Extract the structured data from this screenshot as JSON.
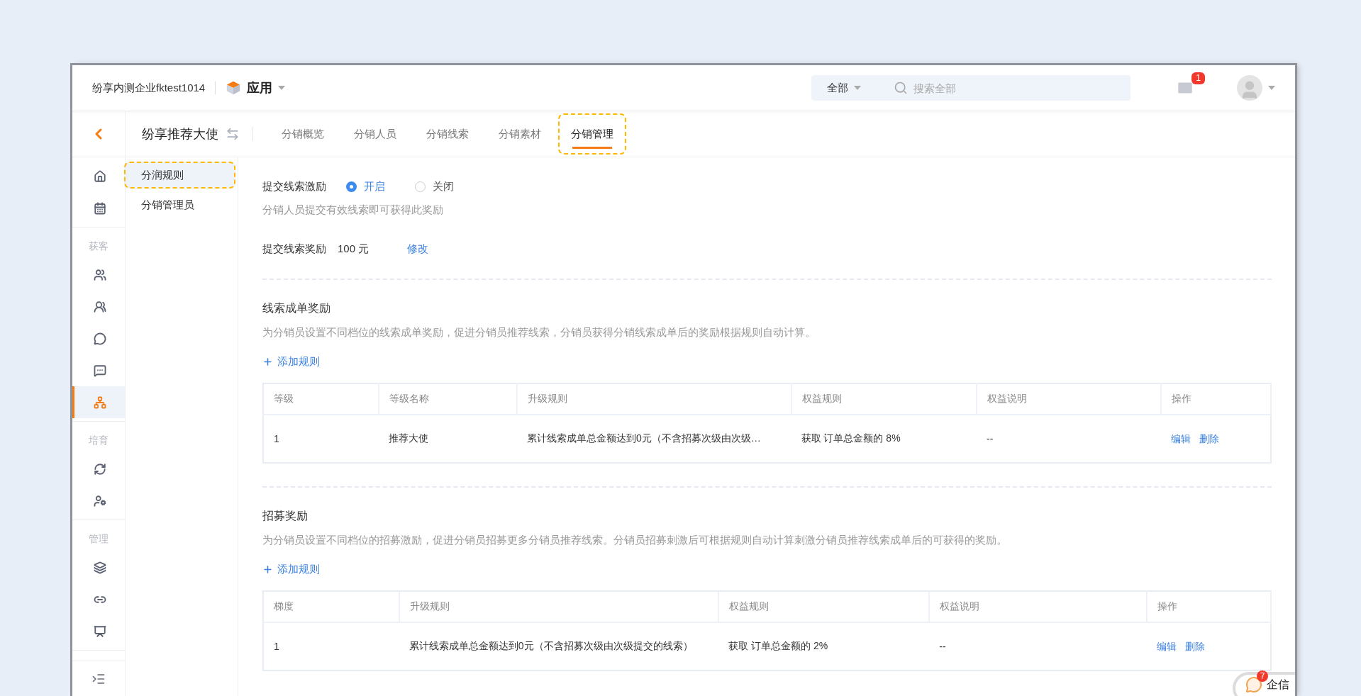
{
  "header": {
    "company": "纷享内测企业fktest1014",
    "app_menu": "应用",
    "search": {
      "scope": "全部",
      "placeholder": "搜索全部"
    },
    "mail_badge": "1"
  },
  "nav_sidebar": {
    "groups": [
      {
        "items": [
          {
            "selected": false
          },
          {
            "selected": false
          }
        ]
      },
      {
        "label": "获客",
        "items": [
          {
            "selected": false
          },
          {
            "selected": false
          },
          {
            "selected": false
          },
          {
            "selected": false
          },
          {
            "selected": true
          }
        ]
      },
      {
        "label": "培育",
        "items": [
          {
            "selected": false
          },
          {
            "selected": false
          }
        ]
      },
      {
        "label": "管理",
        "items": [
          {
            "selected": false
          },
          {
            "selected": false
          },
          {
            "selected": false
          }
        ]
      }
    ]
  },
  "app_title": "纷享推荐大使",
  "tabs": [
    {
      "label": "分销概览",
      "selected": false,
      "highlighted": false
    },
    {
      "label": "分销人员",
      "selected": false,
      "highlighted": false
    },
    {
      "label": "分销线索",
      "selected": false,
      "highlighted": false
    },
    {
      "label": "分销素材",
      "selected": false,
      "highlighted": false
    },
    {
      "label": "分销管理",
      "selected": true,
      "highlighted": true
    }
  ],
  "sub_menu": [
    {
      "label": "分润规则",
      "selected": true,
      "highlighted": true
    },
    {
      "label": "分销管理员",
      "selected": false,
      "highlighted": false
    }
  ],
  "incentive": {
    "label": "提交线索激励",
    "options": [
      {
        "label": "开启",
        "selected": true
      },
      {
        "label": "关闭",
        "selected": false
      }
    ],
    "hint": "分销人员提交有效线索即可获得此奖励",
    "reward_label": "提交线索奖励",
    "reward_value": "100 元",
    "edit_link": "修改"
  },
  "sections": [
    {
      "title": "线索成单奖励",
      "description": "为分销员设置不同档位的线索成单奖励，促进分销员推荐线索，分销员获得分销线索成单后的奖励根据规则自动计算。",
      "add_button": "添加规则",
      "table": {
        "columns": [
          "等级",
          "等级名称",
          "升级规则",
          "权益规则",
          "权益说明",
          "操作"
        ],
        "rows": [
          {
            "cells": [
              "1",
              "推荐大使",
              "累计线索成单总金额达到0元（不含招募次级由次级…",
              "获取 订单总金额的 8%",
              "--"
            ],
            "actions": [
              "编辑",
              "删除"
            ]
          }
        ]
      }
    },
    {
      "title": "招募奖励",
      "description": "为分销员设置不同档位的招募激励，促进分销员招募更多分销员推荐线索。分销员招募刺激后可根据规则自动计算刺激分销员推荐线索成单后的可获得的奖励。",
      "add_button": "添加规则",
      "table": {
        "columns": [
          "梯度",
          "升级规则",
          "权益规则",
          "权益说明",
          "操作"
        ],
        "rows": [
          {
            "cells": [
              "1",
              "累计线索成单总金额达到0元（不含招募次级由次级提交的线索）",
              "获取 订单总金额的 2%",
              "--"
            ],
            "actions": [
              "编辑",
              "删除"
            ]
          }
        ]
      }
    }
  ],
  "chat_widget": {
    "label": "企信",
    "badge": "7"
  }
}
